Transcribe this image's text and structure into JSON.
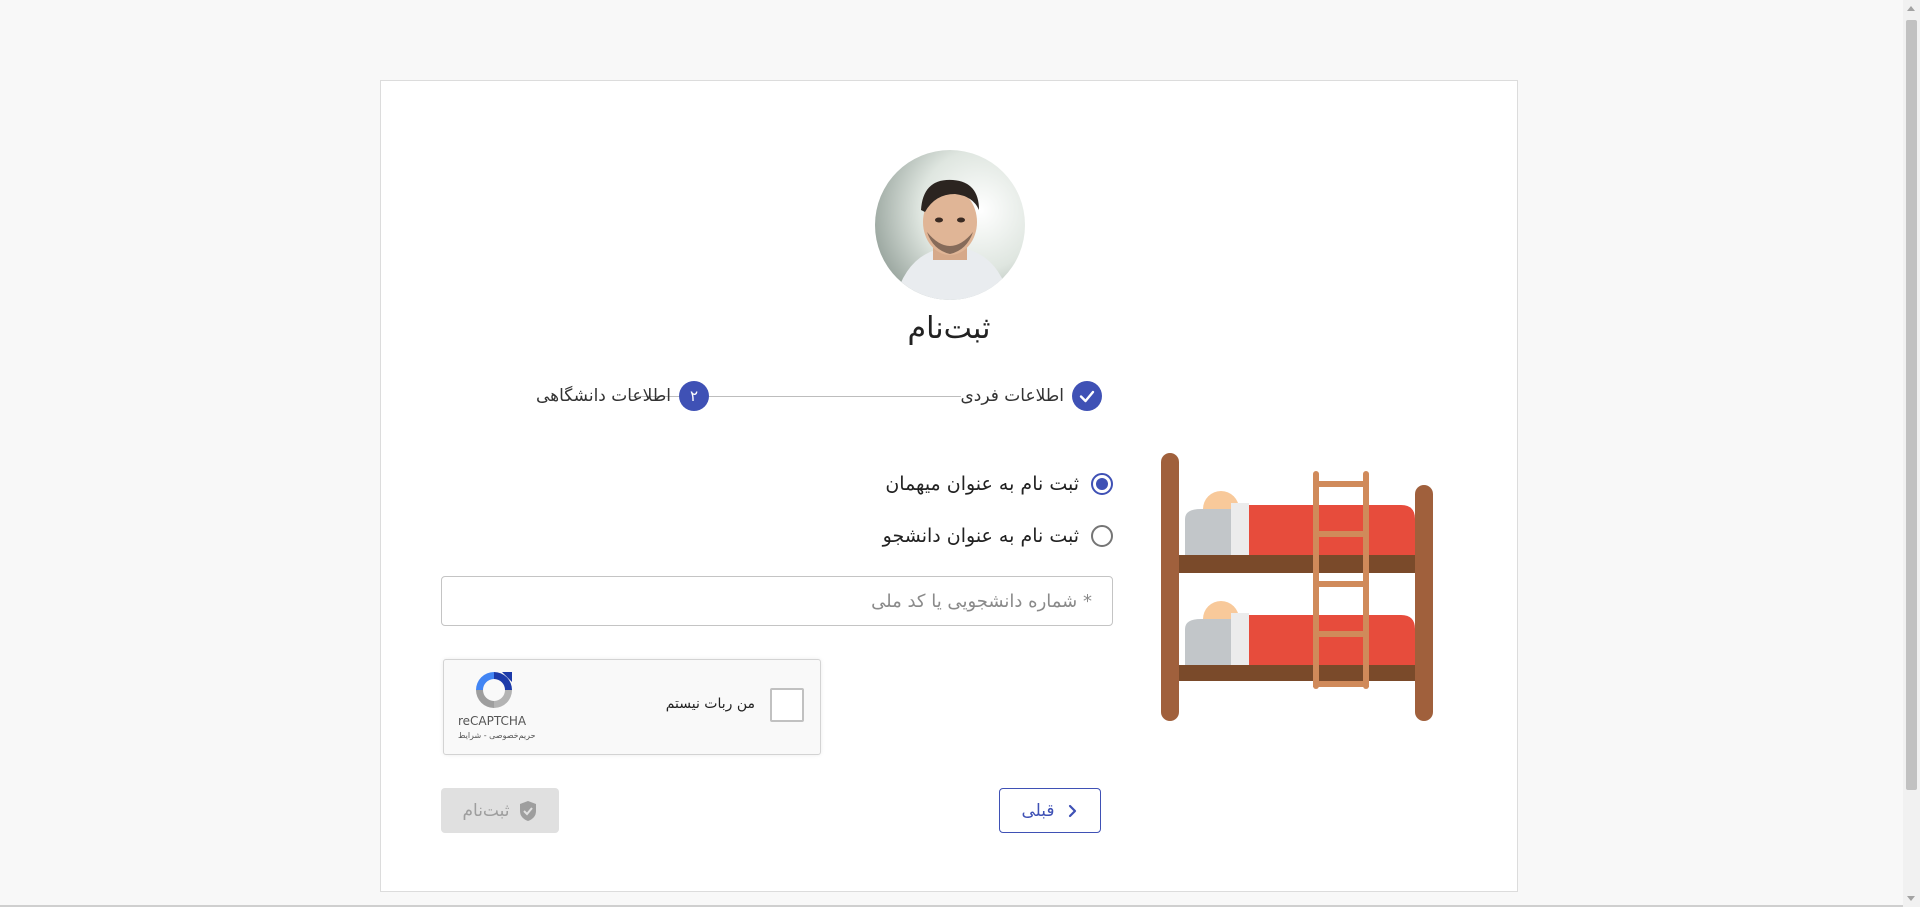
{
  "header": {
    "avatar_alt": "profile-photo",
    "title": "ثبت‌نام"
  },
  "stepper": {
    "steps": [
      {
        "label": "اطلاعات فردی",
        "status": "completed",
        "badge": "✓"
      },
      {
        "label": "اطلاعات دانشگاهی",
        "status": "active",
        "badge": "۲"
      }
    ]
  },
  "registration_type": {
    "options": [
      {
        "label": "ثبت نام به عنوان میهمان",
        "selected": true
      },
      {
        "label": "ثبت نام به عنوان دانشجو",
        "selected": false
      }
    ]
  },
  "student_id": {
    "placeholder": "* شماره دانشجویی یا کد ملی",
    "value": ""
  },
  "captcha": {
    "checkbox_label": "من ربات نیستم",
    "brand": "reCAPTCHA",
    "terms": "حریم‌خصوصی - شرایط"
  },
  "buttons": {
    "prev_label": "قبلی",
    "submit_label": "ثبت‌نام"
  },
  "colors": {
    "primary": "#3f51b5",
    "disabled_bg": "#e0e0e0",
    "disabled_text": "#9e9e9e"
  },
  "illustration": {
    "icon": "bunk-bed-icon"
  }
}
